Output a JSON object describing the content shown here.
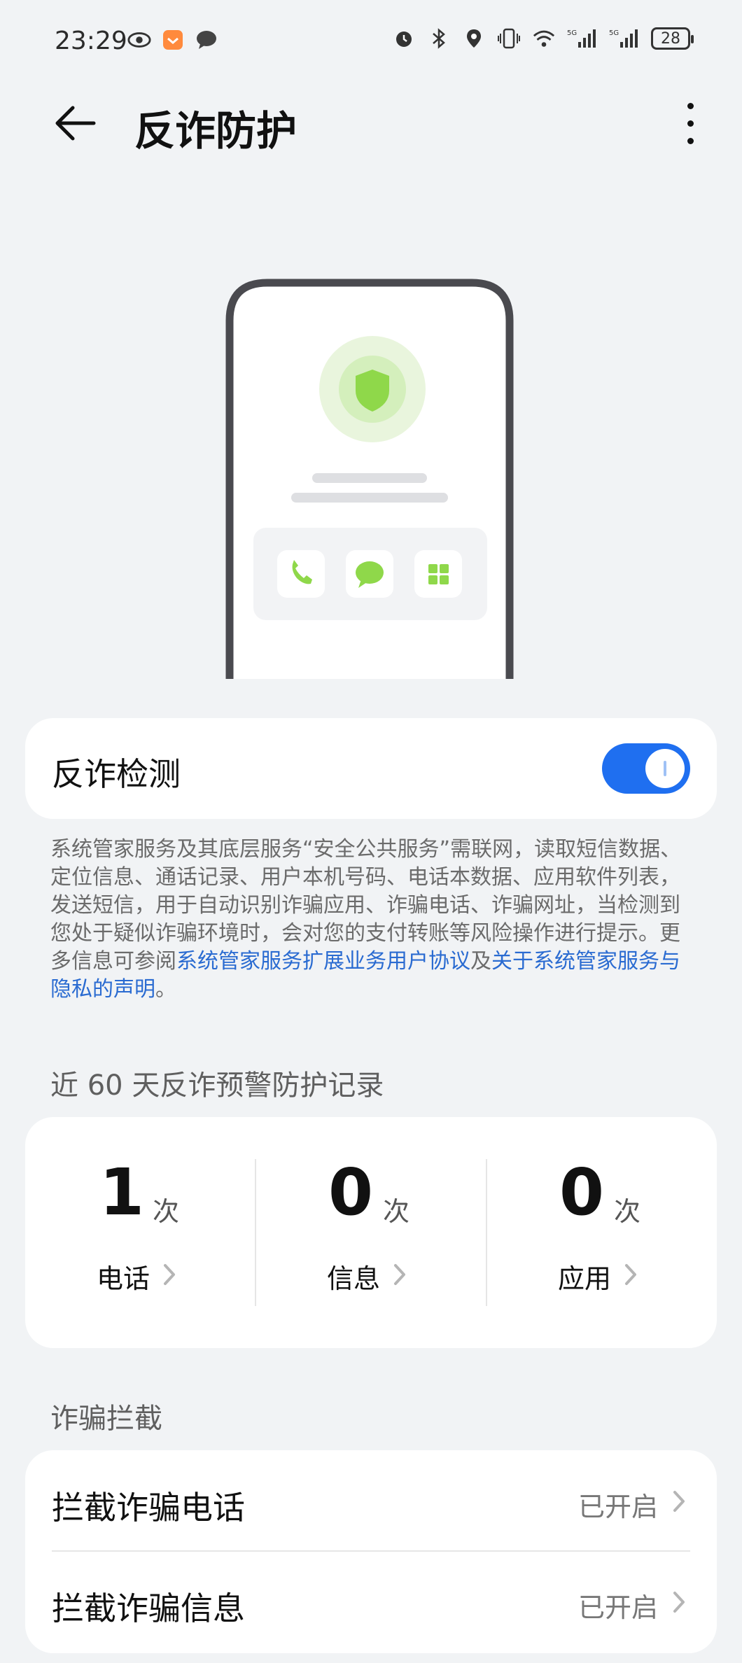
{
  "status_bar": {
    "time": "23:29",
    "battery": "28",
    "left_icons": [
      "eye-icon",
      "app-notification-icon",
      "message-bubble-icon"
    ],
    "right_icons": [
      "alarm-icon",
      "bluetooth-icon",
      "location-icon",
      "vibrate-icon",
      "wifi-icon",
      "signal-5g-icon",
      "signal-5g-icon"
    ]
  },
  "header": {
    "title": "反诈防护",
    "back_icon": "arrow-left-icon",
    "more_icon": "more-vertical-icon"
  },
  "toggle_card": {
    "label": "反诈检测",
    "enabled": true
  },
  "description": {
    "text": "系统管家服务及其底层服务“安全公共服务”需联网，读取短信数据、定位信息、通话记录、用户本机号码、电话本数据、应用软件列表，发送短信，用于自动识别诈骗应用、诈骗电话、诈骗网址，当检测到您处于疑似诈骗环境时，会对您的支付转账等风险操作进行提示。更多信息可参阅",
    "link1": "系统管家服务扩展业务用户协议",
    "and": "及",
    "link2": "关于系统管家服务与隐私的声明",
    "end": "。"
  },
  "records": {
    "title": "近 60 天反诈预警防护记录",
    "items": [
      {
        "count": "1",
        "unit": "次",
        "label": "电话"
      },
      {
        "count": "0",
        "unit": "次",
        "label": "信息"
      },
      {
        "count": "0",
        "unit": "次",
        "label": "应用"
      }
    ]
  },
  "intercept": {
    "title": "诈骗拦截",
    "rows": [
      {
        "label": "拦截诈骗电话",
        "value": "已开启"
      },
      {
        "label": "拦截诈骗信息",
        "value": "已开启"
      }
    ]
  },
  "colors": {
    "accent": "#1f6ff0",
    "link": "#2a6bd1",
    "shield_green": "#8fd84a"
  }
}
